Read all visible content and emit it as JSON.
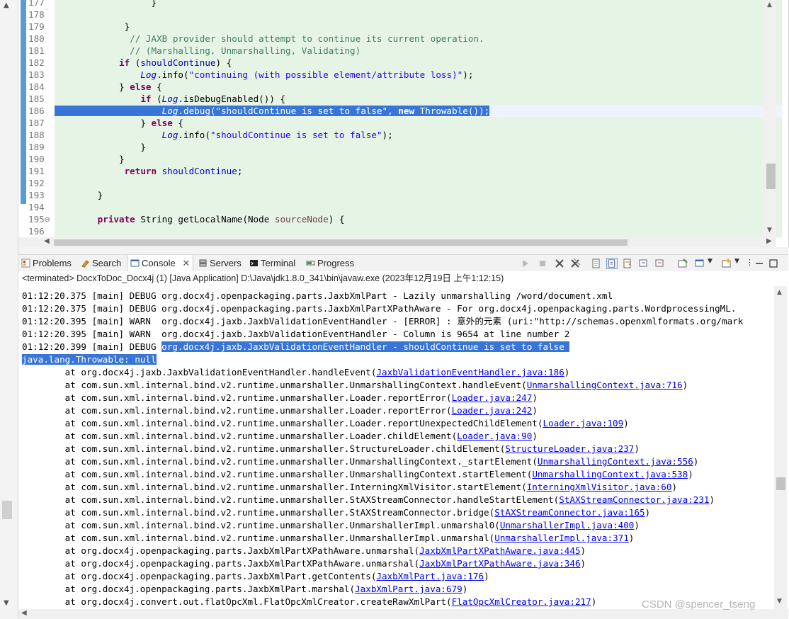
{
  "editor": {
    "lines": [
      {
        "num": "177",
        "parts": [
          [
            "",
            "                  }"
          ]
        ]
      },
      {
        "num": "178",
        "parts": []
      },
      {
        "num": "179",
        "parts": [
          [
            "",
            "             }"
          ]
        ]
      },
      {
        "num": "180",
        "parts": [
          [
            "",
            "              "
          ],
          [
            "cm",
            "// JAXB provider should attempt to continue its current operation."
          ]
        ]
      },
      {
        "num": "181",
        "parts": [
          [
            "",
            "              "
          ],
          [
            "cm",
            "// (Marshalling, Unmarshalling, Validating)"
          ]
        ]
      },
      {
        "num": "182",
        "parts": [
          [
            "",
            "            "
          ],
          [
            "kw",
            "if"
          ],
          [
            "",
            " ("
          ],
          [
            "fld",
            "shouldContinue"
          ],
          [
            "",
            ") {"
          ]
        ]
      },
      {
        "num": "183",
        "parts": [
          [
            "",
            "                "
          ],
          [
            "it",
            "Log"
          ],
          [
            "",
            ".info("
          ],
          [
            "st",
            "\"continuing (with possible element/attribute loss)\""
          ],
          [
            "",
            ");"
          ]
        ]
      },
      {
        "num": "184",
        "parts": [
          [
            "",
            "            } "
          ],
          [
            "kw",
            "else"
          ],
          [
            "",
            " {"
          ]
        ]
      },
      {
        "num": "185",
        "parts": [
          [
            "",
            "                "
          ],
          [
            "kw",
            "if"
          ],
          [
            "",
            " ("
          ],
          [
            "it",
            "Log"
          ],
          [
            "",
            ".isDebugEnabled()) {"
          ]
        ]
      },
      {
        "num": "186",
        "hl": true,
        "parts": [
          [
            "",
            "                    "
          ],
          [
            "it",
            "Log"
          ],
          [
            "",
            ".debug("
          ],
          [
            "st",
            "\"shouldContinue is set to false\""
          ],
          [
            "",
            ", "
          ],
          [
            "kw",
            "new"
          ],
          [
            "",
            " Throwable());"
          ]
        ]
      },
      {
        "num": "187",
        "parts": [
          [
            "",
            "                } "
          ],
          [
            "kw",
            "else"
          ],
          [
            "",
            " {"
          ]
        ]
      },
      {
        "num": "188",
        "parts": [
          [
            "",
            "                    "
          ],
          [
            "it",
            "Log"
          ],
          [
            "",
            ".info("
          ],
          [
            "st",
            "\"shouldContinue is set to false\""
          ],
          [
            "",
            ");"
          ]
        ]
      },
      {
        "num": "189",
        "parts": [
          [
            "",
            "                }"
          ]
        ]
      },
      {
        "num": "190",
        "parts": [
          [
            "",
            "            }"
          ]
        ]
      },
      {
        "num": "191",
        "parts": [
          [
            "",
            "             "
          ],
          [
            "kw",
            "return"
          ],
          [
            "",
            " "
          ],
          [
            "fld",
            "shouldContinue"
          ],
          [
            ";",
            ""
          ]
        ]
      },
      {
        "num": "192",
        "parts": []
      },
      {
        "num": "193",
        "parts": [
          [
            "",
            "        }"
          ]
        ]
      },
      {
        "num": "194",
        "parts": []
      },
      {
        "num": "195",
        "fold": true,
        "parts": [
          [
            "",
            "        "
          ],
          [
            "kw",
            "private"
          ],
          [
            "",
            " String getLocalName(Node "
          ],
          [
            "cm2",
            "sourceNode"
          ],
          [
            "",
            ") {"
          ]
        ]
      },
      {
        "num": "196",
        "parts": []
      }
    ]
  },
  "tabs": [
    {
      "label": "Problems",
      "icon": "problems-icon"
    },
    {
      "label": "Search",
      "icon": "search-icon"
    },
    {
      "label": "Console",
      "icon": "console-icon",
      "active": true
    },
    {
      "label": "Servers",
      "icon": "servers-icon"
    },
    {
      "label": "Terminal",
      "icon": "terminal-icon"
    },
    {
      "label": "Progress",
      "icon": "progress-icon"
    }
  ],
  "status_text": "<terminated> DocxToDoc_Docx4j (1) [Java Application] D:\\Java\\jdk1.8.0_341\\bin\\javaw.exe  (2023年12月19日 上午1:12:15)",
  "console": {
    "lines": [
      {
        "t": "01:12:20.375 [main] DEBUG org.docx4j.openpackaging.parts.JaxbXmlPart - Lazily unmarshalling /word/document.xml"
      },
      {
        "t": "01:12:20.375 [main] DEBUG org.docx4j.openpackaging.parts.JaxbXmlPartXPathAware - For org.docx4j.openpackaging.parts.WordprocessingML."
      },
      {
        "t": "01:12:20.395 [main] WARN  org.docx4j.jaxb.JaxbValidationEventHandler - [ERROR] : 意外的元素 (uri:\"http://schemas.openxmlformats.org/mark"
      },
      {
        "t": "01:12:20.395 [main] WARN  org.docx4j.jaxb.JaxbValidationEventHandler - Column is 9654 at line number 2"
      },
      {
        "t": "01:12:20.399 [main] DEBUG ",
        "hl": "org.docx4j.jaxb.JaxbValidationEventHandler - shouldContinue is set to false "
      },
      {
        "t": "",
        "hl": "java.lang.Throwable: null"
      },
      {
        "t": "        at org.docx4j.jaxb.JaxbValidationEventHandler.handleEvent(",
        "link": "JaxbValidationEventHandler.java:186",
        "end": ")"
      },
      {
        "t": "        at com.sun.xml.internal.bind.v2.runtime.unmarshaller.UnmarshallingContext.handleEvent(",
        "link": "UnmarshallingContext.java:716",
        "end": ")"
      },
      {
        "t": "        at com.sun.xml.internal.bind.v2.runtime.unmarshaller.Loader.reportError(",
        "link": "Loader.java:247",
        "end": ")"
      },
      {
        "t": "        at com.sun.xml.internal.bind.v2.runtime.unmarshaller.Loader.reportError(",
        "link": "Loader.java:242",
        "end": ")"
      },
      {
        "t": "        at com.sun.xml.internal.bind.v2.runtime.unmarshaller.Loader.reportUnexpectedChildElement(",
        "link": "Loader.java:109",
        "end": ")"
      },
      {
        "t": "        at com.sun.xml.internal.bind.v2.runtime.unmarshaller.Loader.childElement(",
        "link": "Loader.java:90",
        "end": ")"
      },
      {
        "t": "        at com.sun.xml.internal.bind.v2.runtime.unmarshaller.StructureLoader.childElement(",
        "link": "StructureLoader.java:237",
        "end": ")"
      },
      {
        "t": "        at com.sun.xml.internal.bind.v2.runtime.unmarshaller.UnmarshallingContext._startElement(",
        "link": "UnmarshallingContext.java:556",
        "end": ")"
      },
      {
        "t": "        at com.sun.xml.internal.bind.v2.runtime.unmarshaller.UnmarshallingContext.startElement(",
        "link": "UnmarshallingContext.java:538",
        "end": ")"
      },
      {
        "t": "        at com.sun.xml.internal.bind.v2.runtime.unmarshaller.InterningXmlVisitor.startElement(",
        "link": "InterningXmlVisitor.java:60",
        "end": ")"
      },
      {
        "t": "        at com.sun.xml.internal.bind.v2.runtime.unmarshaller.StAXStreamConnector.handleStartElement(",
        "link": "StAXStreamConnector.java:231",
        "end": ")"
      },
      {
        "t": "        at com.sun.xml.internal.bind.v2.runtime.unmarshaller.StAXStreamConnector.bridge(",
        "link": "StAXStreamConnector.java:165",
        "end": ")"
      },
      {
        "t": "        at com.sun.xml.internal.bind.v2.runtime.unmarshaller.UnmarshallerImpl.unmarshal0(",
        "link": "UnmarshallerImpl.java:400",
        "end": ")"
      },
      {
        "t": "        at com.sun.xml.internal.bind.v2.runtime.unmarshaller.UnmarshallerImpl.unmarshal(",
        "link": "UnmarshallerImpl.java:371",
        "end": ")"
      },
      {
        "t": "        at org.docx4j.openpackaging.parts.JaxbXmlPartXPathAware.unmarshal(",
        "link": "JaxbXmlPartXPathAware.java:445",
        "end": ")"
      },
      {
        "t": "        at org.docx4j.openpackaging.parts.JaxbXmlPartXPathAware.unmarshal(",
        "link": "JaxbXmlPartXPathAware.java:346",
        "end": ")"
      },
      {
        "t": "        at org.docx4j.openpackaging.parts.JaxbXmlPart.getContents(",
        "link": "JaxbXmlPart.java:176",
        "end": ")"
      },
      {
        "t": "        at org.docx4j.openpackaging.parts.JaxbXmlPart.marshal(",
        "link": "JaxbXmlPart.java:679",
        "end": ")"
      },
      {
        "t": "        at org.docx4j.convert.out.flatOpcXml.FlatOpcXmlCreator.createRawXmlPart(",
        "link": "FlatOpcXmlCreator.java:217",
        "end": ")"
      }
    ]
  },
  "watermark": "CSDN @spencer_tseng",
  "colors": {
    "ruler": "#5b9bd5",
    "selection": "#3875d7",
    "editor_bg": "#e6f4e6",
    "link": "#0000ee"
  }
}
